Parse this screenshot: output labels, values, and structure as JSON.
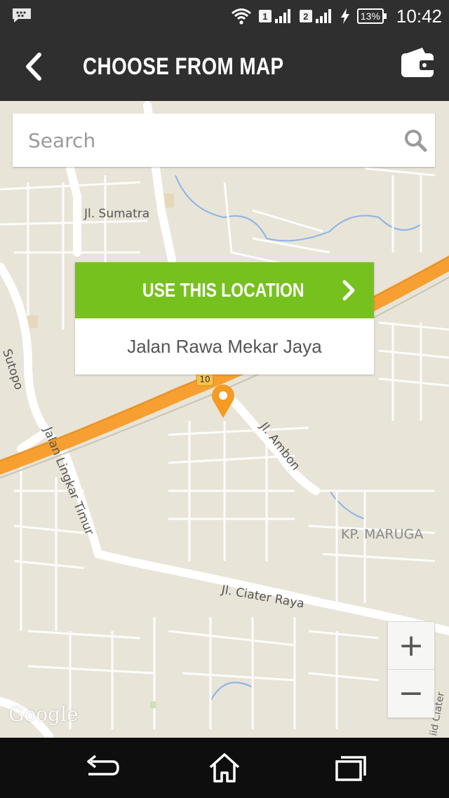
{
  "status_bar": {
    "sim1": "1",
    "sim2": "2",
    "battery": "13%",
    "time": "10:42",
    "icons": [
      "messenger-icon",
      "wifi-icon",
      "signal-icon",
      "charging-icon",
      "battery-icon"
    ]
  },
  "toolbar": {
    "title": "CHOOSE FROM MAP",
    "back_icon": "chevron-left-icon",
    "wallet_icon": "wallet-icon"
  },
  "search": {
    "placeholder": "Search",
    "value": "",
    "icon": "search-icon"
  },
  "location_card": {
    "button_label": "USE THIS LOCATION",
    "address": "Jalan Rawa Mekar Jaya"
  },
  "map": {
    "labels": {
      "sumatra": "Jl. Sumatra",
      "sutopo": "Sutopo",
      "lingkar": "Jalan Lingkar Timur",
      "ambon": "Jl. Ambon",
      "maruga": "KP. MARUGA",
      "ciater_raya": "Jl. Ciater Raya",
      "ciater": "iid Ciater",
      "toll_shield": "10"
    },
    "zoom_in": "+",
    "zoom_out": "−",
    "attribution": "Google",
    "colors": {
      "land": "#e8e4d8",
      "road": "#ffffff",
      "highway": "#f7a031",
      "water": "#8ab4e6",
      "pin": "#f59a23",
      "accent": "#77c11f"
    }
  },
  "nav_bar": {
    "icons": [
      "back-nav-icon",
      "home-icon",
      "recents-icon"
    ]
  }
}
